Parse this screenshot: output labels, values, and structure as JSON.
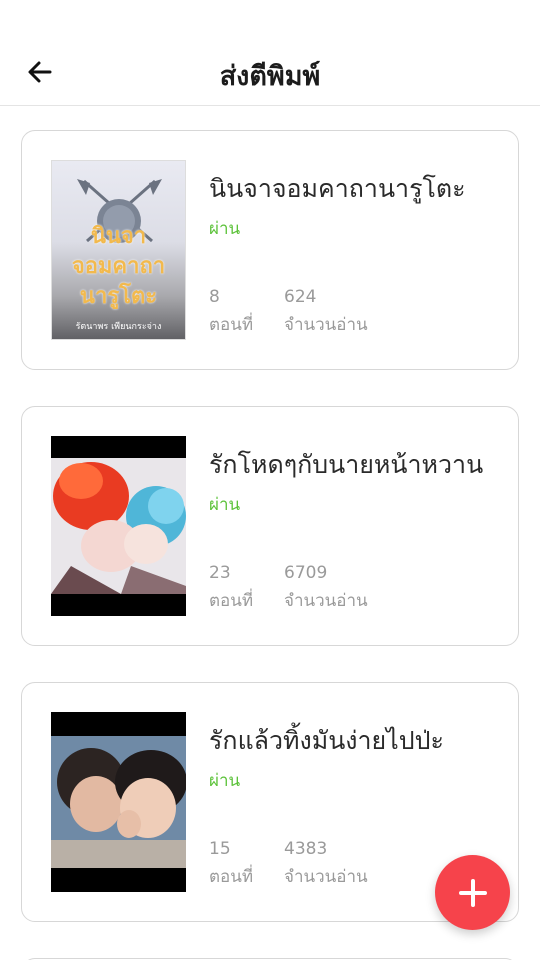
{
  "header": {
    "title": "ส่งตีพิมพ์",
    "back_icon": "arrow-left-icon"
  },
  "books": [
    {
      "title": "นินจาจอมคาถานารูโตะ",
      "status": "ผ่าน",
      "episodes": "8",
      "episodes_label": "ตอนที่",
      "reads": "624",
      "reads_label": "จำนวนอ่าน",
      "cover": {
        "text_line1": "นินจา",
        "text_line2": "จอมคาถา",
        "text_line3": "นารูโตะ",
        "author": "รัตนาพร เพียนกระจ่าง"
      }
    },
    {
      "title": "รักโหดๆกับนายหน้าหวาน",
      "status": "ผ่าน",
      "episodes": "23",
      "episodes_label": "ตอนที่",
      "reads": "6709",
      "reads_label": "จำนวนอ่าน"
    },
    {
      "title": "รักแล้วทิ้งมันง่ายไปป่ะ",
      "status": "ผ่าน",
      "episodes": "15",
      "episodes_label": "ตอนที่",
      "reads": "4383",
      "reads_label": "จำนวนอ่าน"
    }
  ],
  "fab": {
    "icon": "plus-icon"
  },
  "colors": {
    "status_pass": "#5cc23a",
    "fab": "#f6434b"
  }
}
